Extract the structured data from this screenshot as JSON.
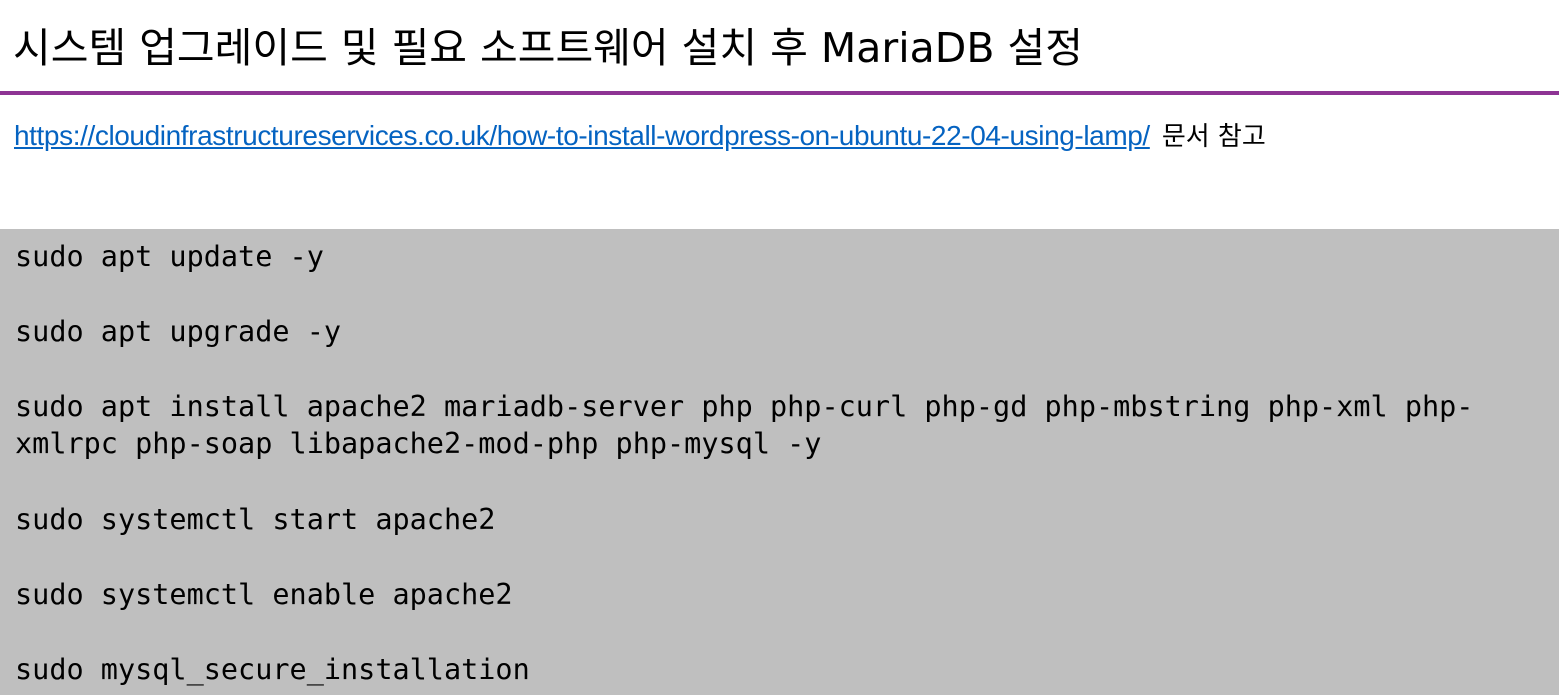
{
  "title": "시스템 업그레이드 및 필요 소프트웨어 설치 후 MariaDB 설정",
  "reference": {
    "link_text": "https://cloudinfrastructureservices.co.uk/how-to-install-wordpress-on-ubuntu-22-04-using-lamp/",
    "suffix": "문서 참고"
  },
  "colors": {
    "rule": "#8e3494",
    "link": "#0563c1",
    "code_background": "#bfbfbf"
  },
  "code_lines": [
    "sudo apt update -y",
    "sudo apt upgrade -y",
    "sudo apt install apache2 mariadb-server php php-curl php-gd php-mbstring php-xml php-",
    "xmlrpc php-soap libapache2-mod-php php-mysql -y",
    "sudo systemctl start apache2",
    "sudo systemctl enable apache2",
    "sudo mysql_secure_installation"
  ]
}
